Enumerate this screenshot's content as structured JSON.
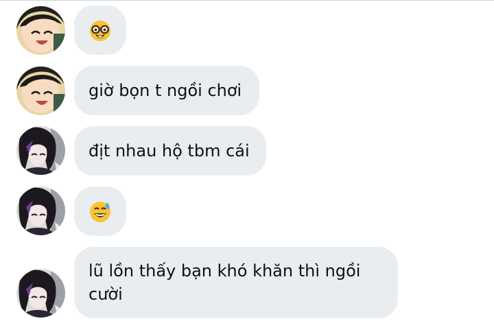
{
  "conversation": {
    "messages": [
      {
        "avatar": "avatar-girl-laughing",
        "type": "emoji",
        "emoji": "nerd-face-icon"
      },
      {
        "avatar": "avatar-girl-laughing",
        "type": "text",
        "text": "giờ bọn t ngồi chơi"
      },
      {
        "avatar": "avatar-shinobu",
        "type": "text",
        "text": "địt nhau hộ tbm cái"
      },
      {
        "avatar": "avatar-shinobu",
        "type": "emoji",
        "emoji": "grinning-sweat-icon"
      },
      {
        "avatar": "avatar-shinobu",
        "type": "text",
        "lines": [
          "lũ lồn thấy bạn khó khăn thì ngồi",
          "cười"
        ]
      }
    ]
  },
  "colors": {
    "bubble": "#e9edf0",
    "text": "#0e1113",
    "divider": "#cfd3d6"
  }
}
